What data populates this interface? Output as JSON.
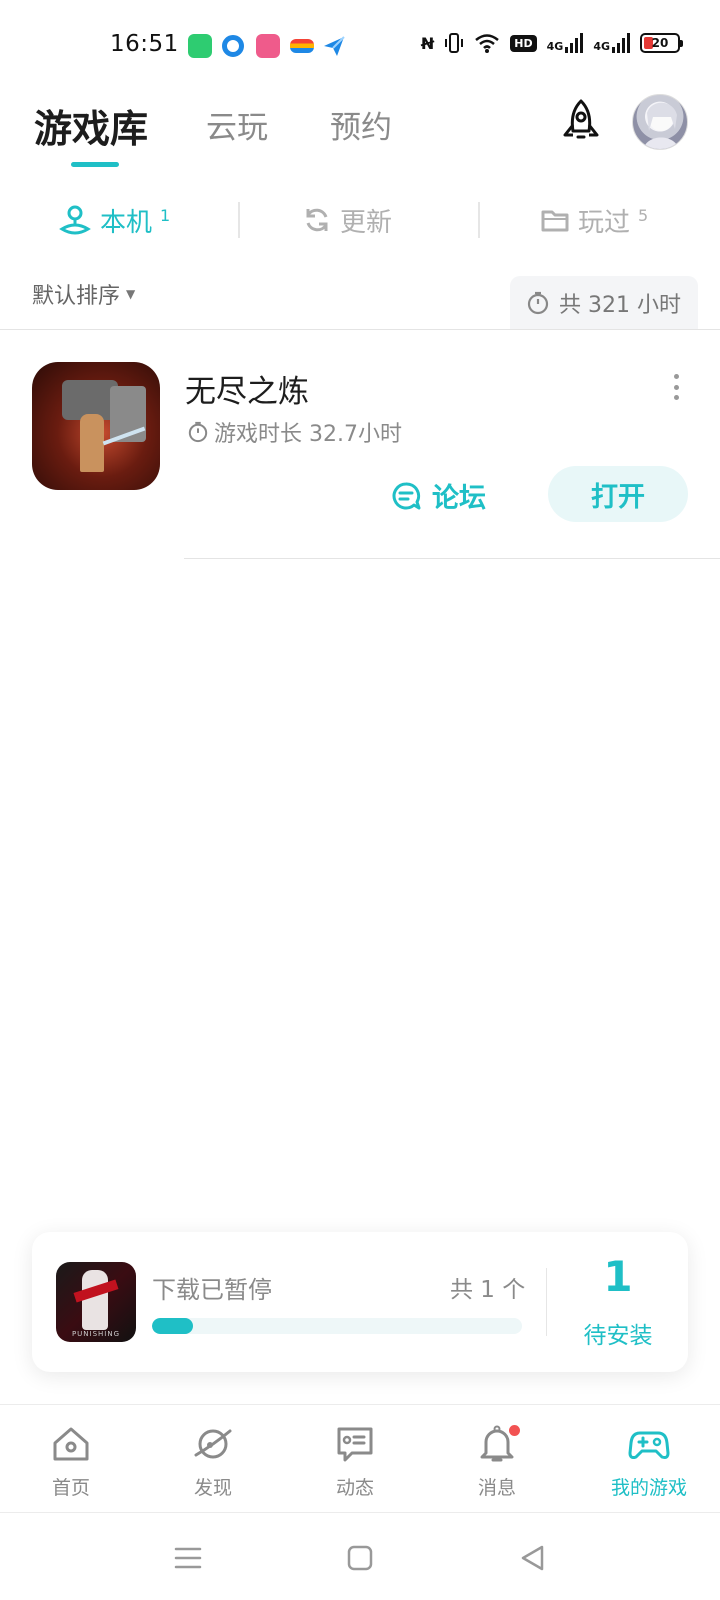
{
  "status_bar": {
    "time": "16:51",
    "hd_label": "HD",
    "signal1_label": "4G",
    "signal2_label": "4G",
    "battery_level": "20",
    "battery_color": "#e53935",
    "notification_icons": [
      "battery-app-icon",
      "browser-app-icon",
      "video-app-icon",
      "wallet-app-icon",
      "plane-app-icon"
    ]
  },
  "header": {
    "tabs": [
      {
        "label": "游戏库",
        "active": true
      },
      {
        "label": "云玩",
        "active": false
      },
      {
        "label": "预约",
        "active": false
      }
    ]
  },
  "subtabs": [
    {
      "label": "本机",
      "count": "1",
      "icon": "map-pin-icon",
      "active": true
    },
    {
      "label": "更新",
      "count": "",
      "icon": "refresh-icon",
      "active": false
    },
    {
      "label": "玩过",
      "count": "5",
      "icon": "folder-icon",
      "active": false
    }
  ],
  "sort": {
    "label": "默认排序",
    "total_time": "共 321 小时"
  },
  "games": [
    {
      "title": "无尽之炼",
      "playtime": "游戏时长 32.7小时",
      "forum_label": "论坛",
      "open_label": "打开"
    }
  ],
  "download": {
    "status": "下载已暂停",
    "total": "共 1 个",
    "progress_fraction": 0.11,
    "pending_count": "1",
    "pending_label": "待安装",
    "icon_text": "PUNISHING"
  },
  "bottom_nav": [
    {
      "label": "首页",
      "icon": "home-icon",
      "active": false
    },
    {
      "label": "发现",
      "icon": "planet-icon",
      "active": false
    },
    {
      "label": "动态",
      "icon": "message-icon",
      "active": false
    },
    {
      "label": "消息",
      "icon": "bell-icon",
      "active": false,
      "badge": true
    },
    {
      "label": "我的游戏",
      "icon": "gamepad-icon",
      "active": true
    }
  ],
  "colors": {
    "accent": "#1fbfc6",
    "badge": "#f25252"
  }
}
